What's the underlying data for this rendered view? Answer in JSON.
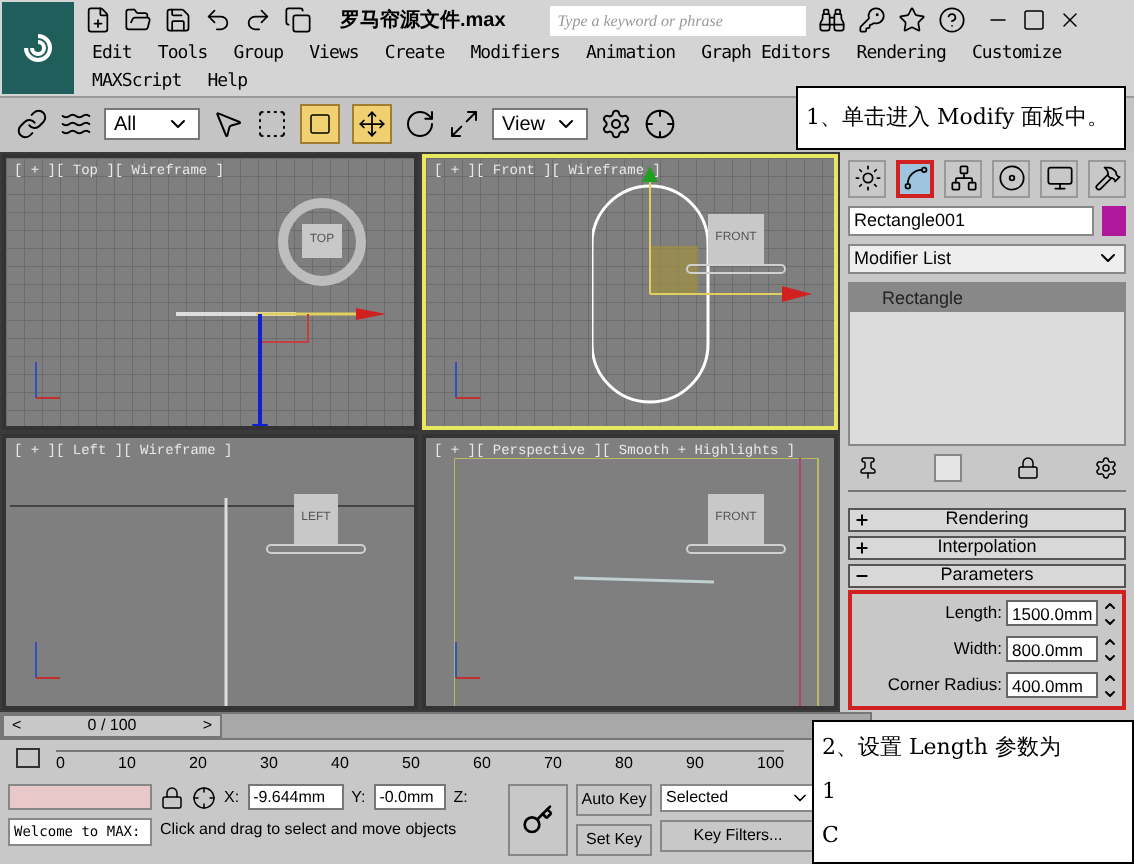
{
  "title_bar": {
    "file_title": "罗马帘源文件.max",
    "search": {
      "placeholder": "Type a keyword or phrase"
    }
  },
  "menu": [
    {
      "label": "Edit"
    },
    {
      "label": "Tools"
    },
    {
      "label": "Group"
    },
    {
      "label": "Views"
    },
    {
      "label": "Create"
    },
    {
      "label": "Modifiers"
    },
    {
      "label": "Animation"
    },
    {
      "label": "Graph Editors"
    },
    {
      "label": "Rendering"
    },
    {
      "label": "Customize"
    },
    {
      "label": "MAXScript"
    },
    {
      "label": "Help"
    }
  ],
  "toolbar": {
    "selection_filter": "All",
    "reference_coord": "View"
  },
  "viewports": [
    {
      "kind": "top",
      "label": "[ + ][ Top ][ Wireframe ]",
      "viewcube_label": "TOP",
      "active": false
    },
    {
      "kind": "front",
      "label": "[ + ][ Front ][ Wireframe ]",
      "viewcube_label": "FRONT",
      "active": true
    },
    {
      "kind": "left",
      "label": "[ + ][ Left ][ Wireframe ]",
      "viewcube_label": "LEFT",
      "active": false
    },
    {
      "kind": "perspective",
      "label": "[ + ][ Perspective ][ Smooth + Highlights ]",
      "viewcube_label": "FRONT",
      "active": false
    }
  ],
  "command_panel": {
    "tabs": [
      {
        "kind": "create",
        "selected": false
      },
      {
        "kind": "modify",
        "selected": true
      },
      {
        "kind": "hierarchy",
        "selected": false
      },
      {
        "kind": "motion",
        "selected": false
      },
      {
        "kind": "display",
        "selected": false
      },
      {
        "kind": "utilities",
        "selected": false
      }
    ],
    "object_name": "Rectangle001",
    "modifier_list": "Modifier List",
    "stack": [
      {
        "label": "Rectangle",
        "selected": true
      }
    ],
    "rollouts": [
      {
        "title": "Rendering",
        "expanded": false
      },
      {
        "title": "Interpolation",
        "expanded": false
      },
      {
        "title": "Parameters",
        "expanded": true,
        "params": [
          {
            "label": "Length:",
            "value": "1500.0mm"
          },
          {
            "label": "Width:",
            "value": "800.0mm"
          },
          {
            "label": "Corner Radius:",
            "value": "400.0mm"
          }
        ]
      }
    ]
  },
  "timeline": {
    "prev": "<",
    "next": ">",
    "position": "0 / 100",
    "level": 0,
    "ticks": [
      "0",
      "10",
      "20",
      "30",
      "40",
      "50",
      "60",
      "70",
      "80",
      "90",
      "100"
    ]
  },
  "status": {
    "welcome": "Welcome to MAX:",
    "x_label": "X:",
    "x": "-9.644mm",
    "y_label": "Y:",
    "y": "-0.0mm",
    "z_label": "Z:",
    "auto_key": "Auto Key",
    "set_key": "Set Key",
    "key_mode": "Selected",
    "key_filters": "Key Filters...",
    "prompt": "Click and drag to select and move objects"
  },
  "callouts": [
    {
      "lines": [
        "1、单击进入 Modify 面板中。"
      ]
    },
    {
      "lines": [
        "2、设置 Length 参数为",
        "1",
        "C"
      ]
    }
  ]
}
